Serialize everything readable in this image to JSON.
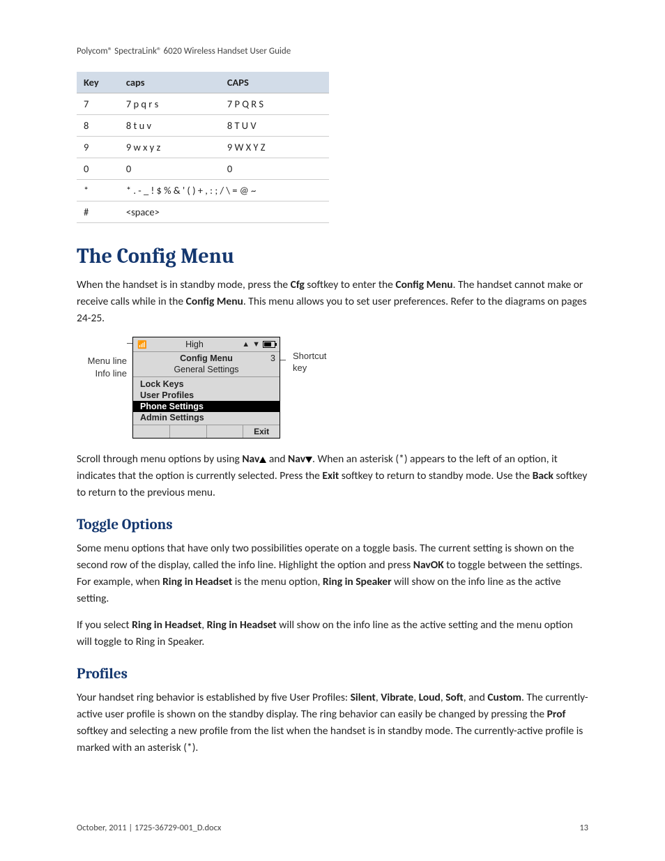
{
  "running_head": "Polycom® SpectraLink® 6020 Wireless Handset User Guide",
  "table": {
    "headers": [
      "Key",
      "caps",
      "CAPS"
    ],
    "rows": [
      {
        "key": "7",
        "caps": "7 p q r s",
        "CAPS": "7 P Q R S"
      },
      {
        "key": "8",
        "caps": "8 t u v",
        "CAPS": "8 T U V"
      },
      {
        "key": "9",
        "caps": "9 w x y z",
        "CAPS": "9 W X Y Z"
      },
      {
        "key": "0",
        "caps": "0",
        "CAPS": "0"
      },
      {
        "key": "*",
        "caps": "* . - _ ! $ % & ' ( ) + ,  :  ; / \\ = @ ~",
        "CAPS": ""
      },
      {
        "key": "#",
        "caps": "<space>",
        "CAPS": ""
      }
    ]
  },
  "h1": "The Config Menu",
  "para1_parts": [
    "When the handset is in standby mode, press the ",
    "Cfg",
    " softkey to enter the ",
    "Config Menu",
    ". The handset cannot make or receive calls while in the ",
    "Config Menu",
    ". This menu allows you to set user preferences. Refer to the diagrams on pages 24-25."
  ],
  "diagram": {
    "left_labels": [
      "Menu line",
      "Info line"
    ],
    "right_label_line1": "Shortcut",
    "right_label_line2": "key",
    "status_text": "High",
    "shortcut_num": "3",
    "title": "Config Menu",
    "info": "General Settings",
    "items": [
      "Lock Keys",
      "User Profiles",
      "Phone Settings",
      "Admin Settings"
    ],
    "selected_index": 2,
    "softkeys": [
      "",
      "",
      "",
      "Exit"
    ]
  },
  "para2_parts": [
    "Scroll through menu options by using ",
    "Nav",
    " and ",
    "Nav",
    ". When an asterisk (*) appears to the left of an option, it indicates that the option is currently selected. Press the ",
    "Exit",
    " softkey to return to standby mode. Use the ",
    "Back",
    " softkey to return to the previous menu."
  ],
  "h2_toggle": "Toggle Options",
  "para3_parts": [
    "Some menu options that have only two possibilities operate on a toggle basis. The current setting is shown on the second row of the display, called the info line. Highlight the option and press ",
    "NavOK",
    " to toggle between the settings. For example, when ",
    "Ring in Headset",
    " is the menu option, ",
    "Ring in Speaker",
    " will show on the info line as the active setting."
  ],
  "para4_parts": [
    "If you select ",
    "Ring in Headset",
    ", ",
    "Ring in Headset",
    " will show on the info line as the active setting and the menu option will toggle to Ring in Speaker."
  ],
  "h2_profiles": "Profiles",
  "para5_parts": [
    "Your handset ring behavior is established by five User Profiles: ",
    "Silent",
    ", ",
    "Vibrate",
    ", ",
    "Loud",
    ", ",
    "Soft",
    ", and ",
    "Custom",
    ". The currently-active user profile is shown on the standby display. The ring behavior can easily be changed by pressing the ",
    "Prof",
    " softkey and selecting a new profile from the list when the handset is in standby mode. The currently-active profile is marked with an asterisk (*)."
  ],
  "footer_left": "October, 2011   |   1725-36729-001_D.docx",
  "footer_right": "13"
}
